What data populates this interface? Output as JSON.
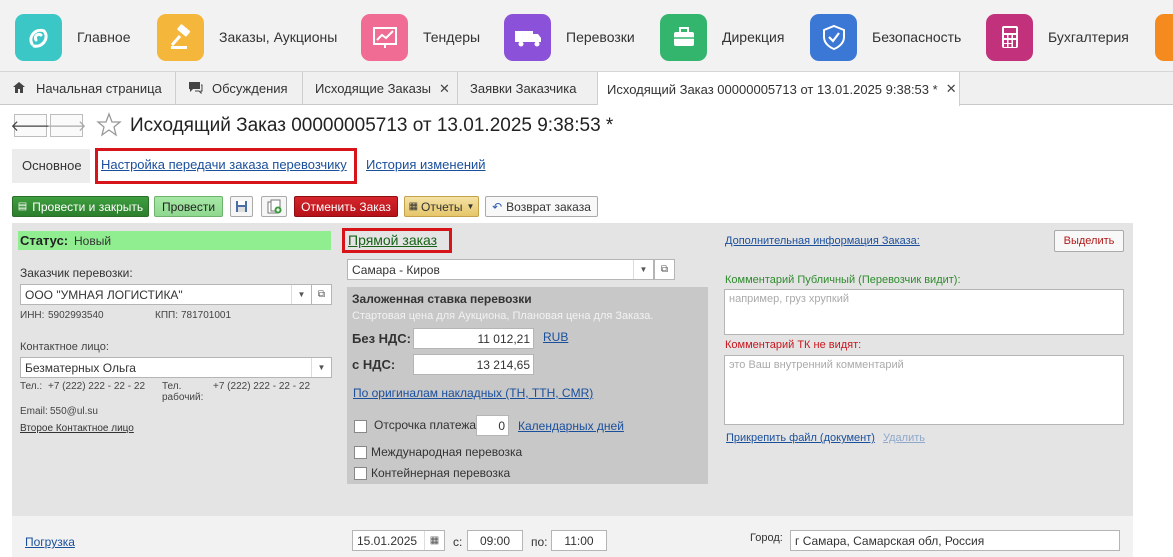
{
  "sections": [
    {
      "label": "Главное",
      "icon": "swirl-icon",
      "color": "#3cc7c7"
    },
    {
      "label": "Заказы, Аукционы",
      "icon": "gavel-icon",
      "color": "#f5b73b"
    },
    {
      "label": "Тендеры",
      "icon": "chart-icon",
      "color": "#f06c95"
    },
    {
      "label": "Перевозки",
      "icon": "truck-icon",
      "color": "#8b52d9"
    },
    {
      "label": "Дирекция",
      "icon": "briefcase-icon",
      "color": "#33b56e"
    },
    {
      "label": "Безопасность",
      "icon": "shield-icon",
      "color": "#3b78d6"
    },
    {
      "label": "Бухгалтерия",
      "icon": "calculator-icon",
      "color": "#c2327c"
    }
  ],
  "tabs": [
    {
      "label": "Начальная страница"
    },
    {
      "label": "Обсуждения"
    },
    {
      "label": "Исходящие Заказы"
    },
    {
      "label": "Заявки Заказчика"
    },
    {
      "label": "Исходящий Заказ 00000005713 от 13.01.2025 9:38:53 *"
    }
  ],
  "title": "Исходящий Заказ 00000005713 от 13.01.2025 9:38:53 *",
  "subtabs": {
    "main": "Основное",
    "transfer": "Настройка передачи заказа перевозчику",
    "history": "История изменений"
  },
  "toolbar": {
    "post_close": "Провести и закрыть",
    "post": "Провести",
    "cancel": "Отменить Заказ",
    "reports": "Отчеты",
    "return": "Возврат заказа"
  },
  "status": {
    "label": "Статус:",
    "value": "Новый"
  },
  "customer": {
    "label": "Заказчик перевозки:",
    "value": "ООО \"УМНАЯ ЛОГИСТИКА\"",
    "inn_label": "ИНН:",
    "inn": "5902993540",
    "kpp_label": "КПП:",
    "kpp": "781701001"
  },
  "contact": {
    "label": "Контактное лицо:",
    "value": "Безматерных Ольга",
    "tel_label": "Тел.:",
    "tel": "+7 (222) 222 - 22 - 22",
    "tel_work_label_1": "Тел.",
    "tel_work_label_2": "рабочий:",
    "tel_work": "+7 (222) 222 - 22 - 22",
    "email_label": "Email:",
    "email": "550@ul.su",
    "second": "Второе Контактное лицо"
  },
  "order_type": "Прямой заказ",
  "route": "Самара - Киров",
  "rate": {
    "title": "Заложенная ставка перевозки",
    "subtitle": "Стартовая цена для Аукциона, Плановая цена для Заказа.",
    "no_vat_label": "Без НДС:",
    "no_vat": "11 012,21",
    "currency": "RUB",
    "vat_label": "с НДС:",
    "vat": "13 214,65",
    "by_originals": "По оригиналам накладных (ТН, ТТН, CMR)",
    "deferral_label": "Отсрочка платежа:",
    "deferral": "0",
    "days": "Календарных дней",
    "international": "Международная перевозка",
    "container": "Контейнерная перевозка"
  },
  "right": {
    "additional": "Дополнительная информация Заказа:",
    "select_btn": "Выделить",
    "public_label": "Комментарий Публичный (Перевозчик видит):",
    "public_placeholder": "например, груз хрупкий",
    "private_label": "Комментарий ТК не видят:",
    "private_placeholder": "это Ваш внутренний комментарий",
    "attach": "Прикрепить файл (документ)",
    "delete": "Удалить"
  },
  "loading": {
    "label": "Погрузка",
    "date": "15.01.2025",
    "from_label": "с:",
    "from": "09:00",
    "to_label": "по:",
    "to": "11:00",
    "city_label": "Город:",
    "city": "г Самара, Самарская обл, Россия"
  },
  "colors": {
    "accent_red": "#d7141a",
    "status_green": "#90ee90",
    "green_btn": "#2e8b2e",
    "cancel_red": "#c8161d"
  }
}
